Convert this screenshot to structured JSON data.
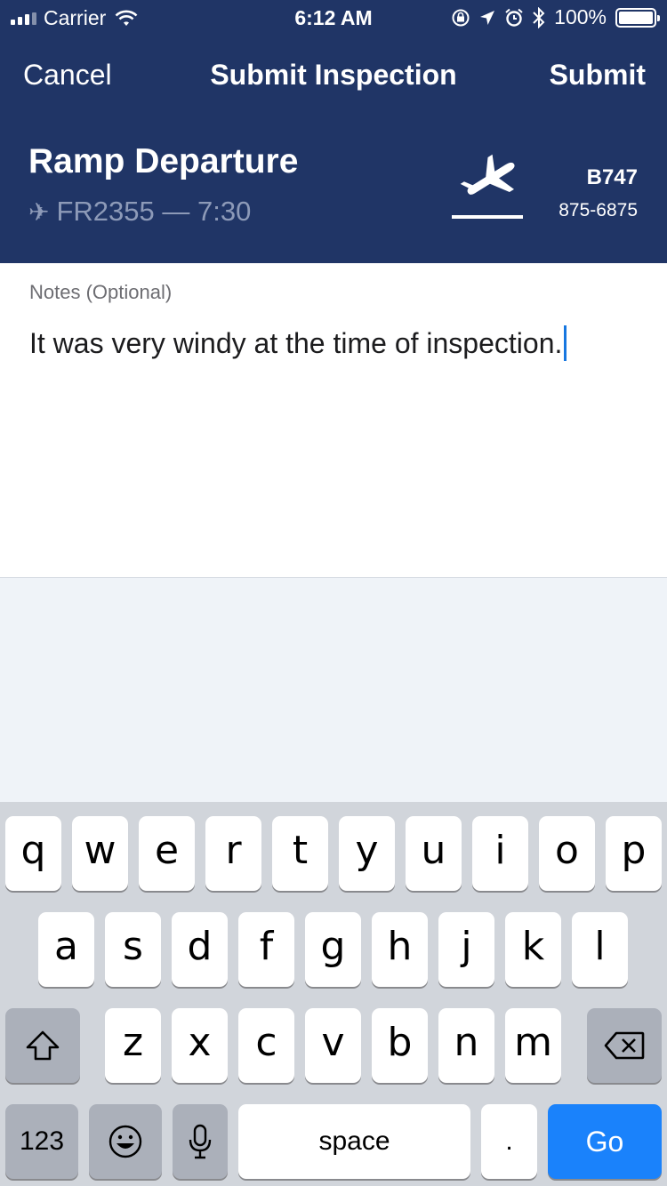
{
  "status_bar": {
    "carrier": "Carrier",
    "time": "6:12 AM",
    "battery": "100%"
  },
  "nav": {
    "cancel_label": "Cancel",
    "title": "Submit Inspection",
    "submit_label": "Submit"
  },
  "header": {
    "title": "Ramp Departure",
    "flight_icon": "✈",
    "flight": "FR2355 — 7:30",
    "aircraft": "B747",
    "phone": "875-6875"
  },
  "notes": {
    "label": "Notes (Optional)",
    "value": "It was very windy at the time of inspection."
  },
  "keyboard": {
    "row1": [
      "q",
      "w",
      "e",
      "r",
      "t",
      "y",
      "u",
      "i",
      "o",
      "p"
    ],
    "row2": [
      "a",
      "s",
      "d",
      "f",
      "g",
      "h",
      "j",
      "k",
      "l"
    ],
    "row3": [
      "z",
      "x",
      "c",
      "v",
      "b",
      "n",
      "m"
    ],
    "numbers_label": "123",
    "space_label": "space",
    "period_label": ".",
    "go_label": "Go"
  },
  "colors": {
    "header_bg": "#203566",
    "go_key": "#1a82fb",
    "caret": "#1777e0"
  }
}
